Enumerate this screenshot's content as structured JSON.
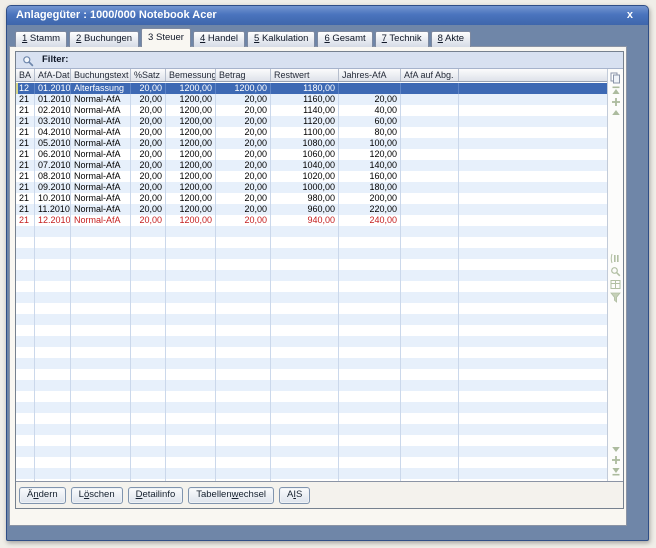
{
  "window": {
    "title": "Anlagegüter : 1000/000 Notebook Acer",
    "close": "x"
  },
  "tabs": [
    {
      "name": "stamm",
      "num": "1",
      "label": "Stamm"
    },
    {
      "name": "buchungen",
      "num": "2",
      "label": "Buchungen"
    },
    {
      "name": "steuer",
      "num": "3",
      "label": "Steuer"
    },
    {
      "name": "handel",
      "num": "4",
      "label": "Handel"
    },
    {
      "name": "kalkulation",
      "num": "5",
      "label": "Kalkulation"
    },
    {
      "name": "gesamt",
      "num": "6",
      "label": "Gesamt"
    },
    {
      "name": "technik",
      "num": "7",
      "label": "Technik"
    },
    {
      "name": "akte",
      "num": "8",
      "label": "Akte"
    }
  ],
  "active_tab_index": 2,
  "filter": {
    "label": "Filter:"
  },
  "grid": {
    "columns": [
      {
        "key": "ba",
        "label": "BA",
        "width": 19,
        "align": "left"
      },
      {
        "key": "afa_dat",
        "label": "AfA-Dat",
        "width": 36,
        "align": "left"
      },
      {
        "key": "buchungstext",
        "label": "Buchungstext",
        "width": 60,
        "align": "left"
      },
      {
        "key": "satz",
        "label": "%Satz",
        "width": 35,
        "align": "right"
      },
      {
        "key": "bemessung",
        "label": "Bemessung",
        "width": 50,
        "align": "right"
      },
      {
        "key": "betrag",
        "label": "Betrag",
        "width": 55,
        "align": "right"
      },
      {
        "key": "restwert",
        "label": "Restwert",
        "width": 68,
        "align": "right"
      },
      {
        "key": "jahres_afa",
        "label": "Jahres-AfA",
        "width": 62,
        "align": "right"
      },
      {
        "key": "afa_abg",
        "label": "AfA auf Abg.",
        "width": 58,
        "align": "right"
      }
    ],
    "rows": [
      {
        "state": "selected",
        "ba": "12",
        "afa_dat": "01.2010",
        "buchungstext": "Alterfassung",
        "satz": "20,00",
        "bemessung": "1200,00",
        "betrag": "1200,00",
        "restwert": "1180,00",
        "jahres_afa": "",
        "afa_abg": ""
      },
      {
        "state": "normal",
        "ba": "21",
        "afa_dat": "01.2010",
        "buchungstext": "Normal-AfA",
        "satz": "20,00",
        "bemessung": "1200,00",
        "betrag": "20,00",
        "restwert": "1160,00",
        "jahres_afa": "20,00",
        "afa_abg": ""
      },
      {
        "state": "normal",
        "ba": "21",
        "afa_dat": "02.2010",
        "buchungstext": "Normal-AfA",
        "satz": "20,00",
        "bemessung": "1200,00",
        "betrag": "20,00",
        "restwert": "1140,00",
        "jahres_afa": "40,00",
        "afa_abg": ""
      },
      {
        "state": "normal",
        "ba": "21",
        "afa_dat": "03.2010",
        "buchungstext": "Normal-AfA",
        "satz": "20,00",
        "bemessung": "1200,00",
        "betrag": "20,00",
        "restwert": "1120,00",
        "jahres_afa": "60,00",
        "afa_abg": ""
      },
      {
        "state": "normal",
        "ba": "21",
        "afa_dat": "04.2010",
        "buchungstext": "Normal-AfA",
        "satz": "20,00",
        "bemessung": "1200,00",
        "betrag": "20,00",
        "restwert": "1100,00",
        "jahres_afa": "80,00",
        "afa_abg": ""
      },
      {
        "state": "normal",
        "ba": "21",
        "afa_dat": "05.2010",
        "buchungstext": "Normal-AfA",
        "satz": "20,00",
        "bemessung": "1200,00",
        "betrag": "20,00",
        "restwert": "1080,00",
        "jahres_afa": "100,00",
        "afa_abg": ""
      },
      {
        "state": "normal",
        "ba": "21",
        "afa_dat": "06.2010",
        "buchungstext": "Normal-AfA",
        "satz": "20,00",
        "bemessung": "1200,00",
        "betrag": "20,00",
        "restwert": "1060,00",
        "jahres_afa": "120,00",
        "afa_abg": ""
      },
      {
        "state": "normal",
        "ba": "21",
        "afa_dat": "07.2010",
        "buchungstext": "Normal-AfA",
        "satz": "20,00",
        "bemessung": "1200,00",
        "betrag": "20,00",
        "restwert": "1040,00",
        "jahres_afa": "140,00",
        "afa_abg": ""
      },
      {
        "state": "normal",
        "ba": "21",
        "afa_dat": "08.2010",
        "buchungstext": "Normal-AfA",
        "satz": "20,00",
        "bemessung": "1200,00",
        "betrag": "20,00",
        "restwert": "1020,00",
        "jahres_afa": "160,00",
        "afa_abg": ""
      },
      {
        "state": "normal",
        "ba": "21",
        "afa_dat": "09.2010",
        "buchungstext": "Normal-AfA",
        "satz": "20,00",
        "bemessung": "1200,00",
        "betrag": "20,00",
        "restwert": "1000,00",
        "jahres_afa": "180,00",
        "afa_abg": ""
      },
      {
        "state": "normal",
        "ba": "21",
        "afa_dat": "10.2010",
        "buchungstext": "Normal-AfA",
        "satz": "20,00",
        "bemessung": "1200,00",
        "betrag": "20,00",
        "restwert": "980,00",
        "jahres_afa": "200,00",
        "afa_abg": ""
      },
      {
        "state": "normal",
        "ba": "21",
        "afa_dat": "11.2010",
        "buchungstext": "Normal-AfA",
        "satz": "20,00",
        "bemessung": "1200,00",
        "betrag": "20,00",
        "restwert": "960,00",
        "jahres_afa": "220,00",
        "afa_abg": ""
      },
      {
        "state": "warning",
        "ba": "21",
        "afa_dat": "12.2010",
        "buchungstext": "Normal-AfA",
        "satz": "20,00",
        "bemessung": "1200,00",
        "betrag": "20,00",
        "restwert": "940,00",
        "jahres_afa": "240,00",
        "afa_abg": ""
      }
    ],
    "empty_rows": 24
  },
  "buttons": [
    {
      "name": "aendern",
      "pre": "Ä",
      "mn": "n",
      "post": "dern"
    },
    {
      "name": "loeschen",
      "pre": "L",
      "mn": "ö",
      "post": "schen"
    },
    {
      "name": "detailinfo",
      "pre": "",
      "mn": "D",
      "post": "etailinfo"
    },
    {
      "name": "tabellenwechsel",
      "pre": "Tabellen",
      "mn": "w",
      "post": "echsel"
    },
    {
      "name": "ais",
      "pre": "A",
      "mn": "I",
      "post": "S"
    }
  ],
  "icons": {
    "filter_search": "magnifier",
    "copy": "copy-sheets",
    "scroll_first": "bar-with-up-arrow",
    "page_up": "plus-marker",
    "up": "chevron-up",
    "columns": "column-bars",
    "search": "magnifier-small",
    "table": "grid-table",
    "filter_funnel": "funnel",
    "down": "chevron-down",
    "page_down": "plus-marker",
    "scroll_last": "bar-with-down-arrow"
  },
  "colors": {
    "titlebar": "#4A74BE",
    "frame": "#6F86A8",
    "selected_row_bg": "#3D69B4",
    "row_alt_bg": "#E7F0FB",
    "warning_text": "#C41E1E",
    "panel_bg": "#F9F7F2",
    "filter_bg": "#D8E1F1"
  }
}
